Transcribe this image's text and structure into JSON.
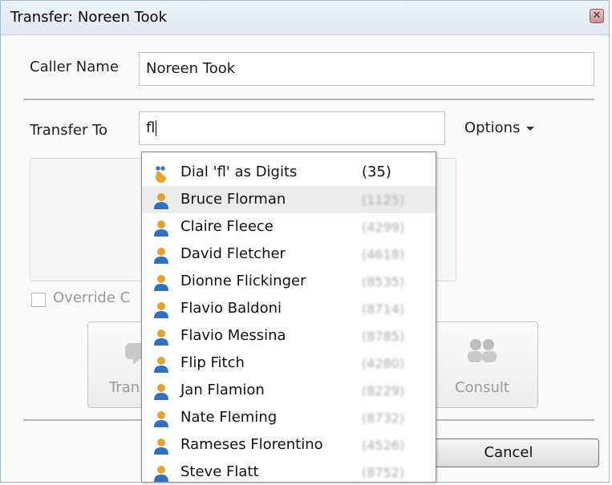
{
  "window": {
    "title": "Transfer: Noreen Took"
  },
  "caller": {
    "label": "Caller Name",
    "value": "Noreen Took"
  },
  "transfer": {
    "label": "Transfer To",
    "value": "fl"
  },
  "options": {
    "label": "Options"
  },
  "override": {
    "label": "Override C"
  },
  "buttons": {
    "transfer_label": "Tran",
    "consult_label": "Consult",
    "cancel_label": "Cancel"
  },
  "dropdown": {
    "dial_item": {
      "label": "Dial 'fl' as Digits",
      "count": "(35)"
    },
    "contacts": [
      {
        "name": "Bruce Florman",
        "ext": "(1125)"
      },
      {
        "name": "Claire Fleece",
        "ext": "(4299)"
      },
      {
        "name": "David Fletcher",
        "ext": "(4618)"
      },
      {
        "name": "Dionne Flickinger",
        "ext": "(8535)"
      },
      {
        "name": "Flavio Baldoni",
        "ext": "(8714)"
      },
      {
        "name": "Flavio Messina",
        "ext": "(8785)"
      },
      {
        "name": "Flip Fitch",
        "ext": "(4280)"
      },
      {
        "name": "Jan Flamion",
        "ext": "(8229)"
      },
      {
        "name": "Nate Fleming",
        "ext": "(8732)"
      },
      {
        "name": "Rameses Florentino",
        "ext": "(4526)"
      },
      {
        "name": "Steve Flatt",
        "ext": "(8752)"
      }
    ]
  },
  "colors": {
    "accent": "#3a78c8",
    "contact_icon_body": "#2f6fc4",
    "contact_icon_head": "#e2a330"
  }
}
